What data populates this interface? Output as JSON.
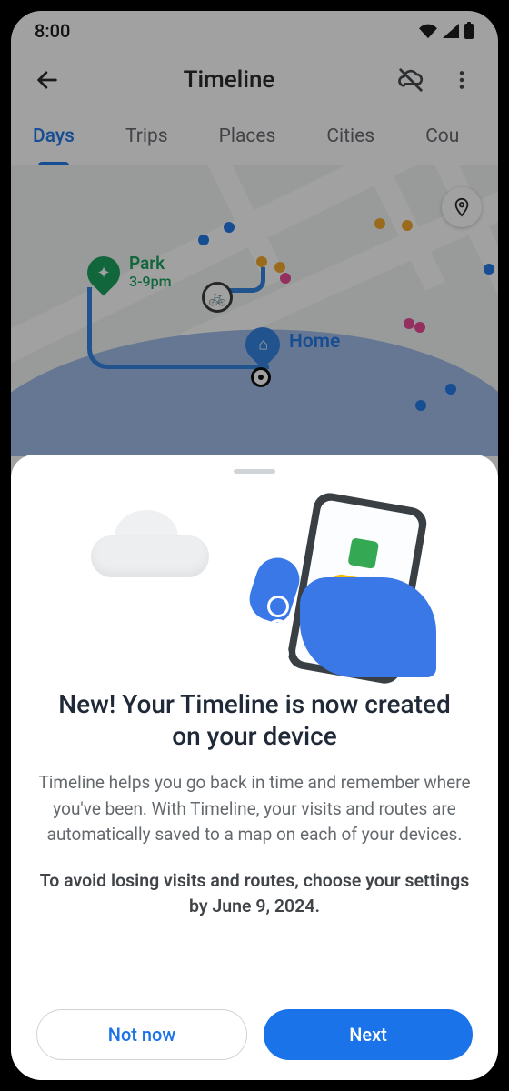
{
  "status": {
    "time": "8:00"
  },
  "header": {
    "title": "Timeline"
  },
  "tabs": [
    "Days",
    "Trips",
    "Places",
    "Cities",
    "Cou"
  ],
  "map": {
    "park": {
      "name": "Park",
      "time": "3-9pm"
    },
    "home": {
      "label": "Home"
    }
  },
  "sheet": {
    "title": "New! Your Timeline is now created on your device",
    "description": "Timeline helps you go back in time and remember where you've been.  With Timeline, your visits and routes are automatically saved to a map on each of your devices.",
    "warning": "To avoid losing visits and routes, choose your settings by June 9, 2024.",
    "actions": {
      "secondary": "Not now",
      "primary": "Next"
    }
  }
}
